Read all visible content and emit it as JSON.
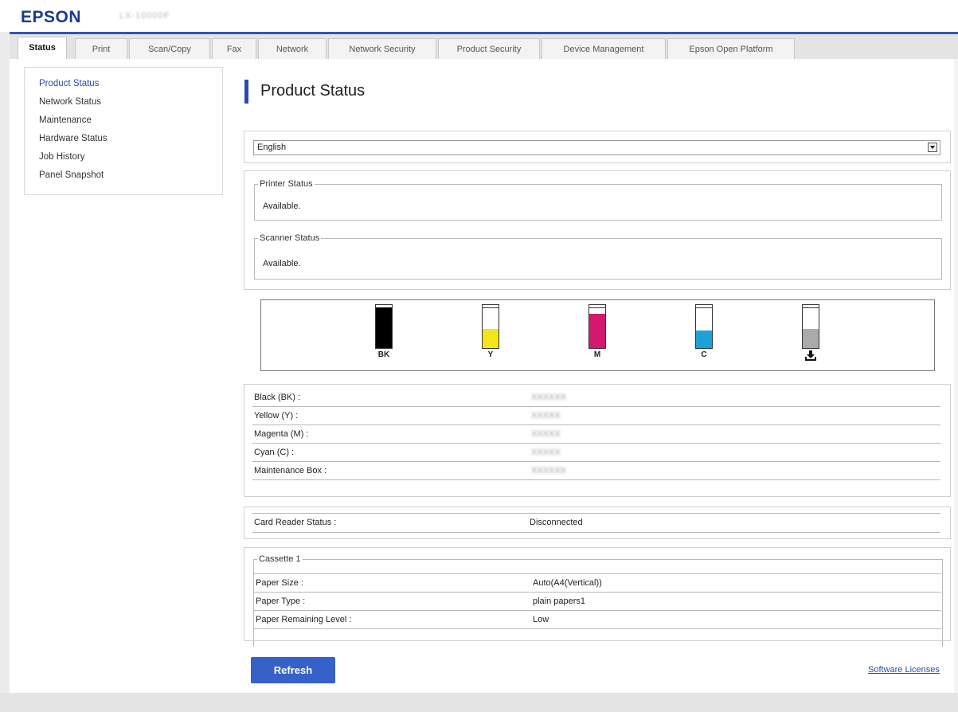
{
  "header": {
    "brand": "EPSON",
    "model": "LX-10000F"
  },
  "tabs": [
    {
      "label": "Status",
      "active": true
    },
    {
      "label": "Print"
    },
    {
      "label": "Scan/Copy"
    },
    {
      "label": "Fax"
    },
    {
      "label": "Network"
    },
    {
      "label": "Network Security"
    },
    {
      "label": "Product Security"
    },
    {
      "label": "Device Management"
    },
    {
      "label": "Epson Open Platform"
    }
  ],
  "sidebar": {
    "items": [
      {
        "label": "Product Status",
        "active": true
      },
      {
        "label": "Network Status"
      },
      {
        "label": "Maintenance"
      },
      {
        "label": "Hardware Status"
      },
      {
        "label": "Job History"
      },
      {
        "label": "Panel Snapshot"
      }
    ]
  },
  "page": {
    "title": "Product Status"
  },
  "language": {
    "selected": "English"
  },
  "status_groups": [
    {
      "legend": "Printer Status",
      "value": "Available."
    },
    {
      "legend": "Scanner Status",
      "value": "Available."
    }
  ],
  "ink": {
    "tanks": [
      {
        "label": "BK",
        "color": "#000000",
        "level": 0.95
      },
      {
        "label": "Y",
        "color": "#f2e51c",
        "level": 0.45
      },
      {
        "label": "M",
        "color": "#d4176f",
        "level": 0.8
      },
      {
        "label": "C",
        "color": "#1ea0d8",
        "level": 0.4
      },
      {
        "label": "",
        "icon": "maintenance-box-icon",
        "color": "#aaaaaa",
        "level": 0.45
      }
    ]
  },
  "consumables": [
    {
      "label": "Black (BK) :",
      "value": "XXXXXX"
    },
    {
      "label": "Yellow (Y) :",
      "value": "XXXXX"
    },
    {
      "label": "Magenta (M) :",
      "value": "XXXXX"
    },
    {
      "label": "Cyan (C) :",
      "value": "XXXXX"
    },
    {
      "label": "Maintenance Box :",
      "value": "XXXXXX"
    }
  ],
  "card_reader": {
    "label": "Card Reader Status :",
    "value": "Disconnected"
  },
  "cassette": {
    "legend": "Cassette 1",
    "rows": [
      {
        "label": "Paper Size :",
        "value": "Auto(A4(Vertical))"
      },
      {
        "label": "Paper Type :",
        "value": "plain papers1"
      },
      {
        "label": "Paper Remaining Level :",
        "value": "Low"
      }
    ]
  },
  "actions": {
    "refresh": "Refresh",
    "licenses": "Software Licenses"
  }
}
